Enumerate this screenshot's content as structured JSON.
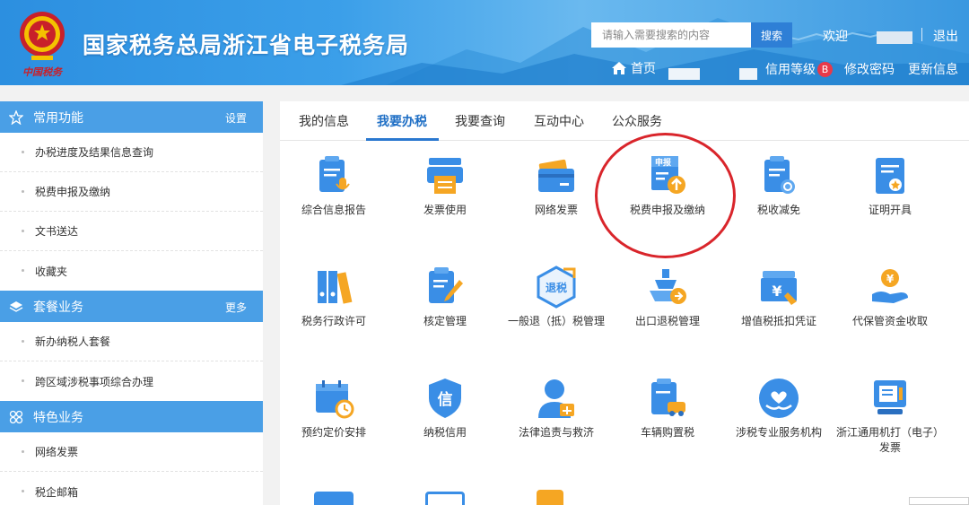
{
  "header": {
    "title": "国家税务总局浙江省电子税务局",
    "search_placeholder": "请输入需要搜索的内容",
    "search_btn": "搜索",
    "welcome": "欢迎",
    "logout": "退出",
    "home": "首页",
    "credit": "信用等级",
    "credit_grade": "B",
    "change_password": "修改密码",
    "update_info": "更新信息"
  },
  "sidebar": {
    "common": {
      "title": "常用功能",
      "action": "设置"
    },
    "common_items": [
      "办税进度及结果信息查询",
      "税费申报及缴纳",
      "文书送达",
      "收藏夹"
    ],
    "package": {
      "title": "套餐业务",
      "action": "更多"
    },
    "package_items": [
      "新办纳税人套餐",
      "跨区域涉税事项综合办理"
    ],
    "special": {
      "title": "特色业务"
    },
    "special_items": [
      "网络发票",
      "税企邮箱"
    ]
  },
  "tabs": [
    "我的信息",
    "我要办税",
    "我要查询",
    "互动中心",
    "公众服务"
  ],
  "active_tab": "我要办税",
  "grid": [
    {
      "label": "综合信息报告",
      "icon": "report-mic-icon"
    },
    {
      "label": "发票使用",
      "icon": "printer-icon"
    },
    {
      "label": "网络发票",
      "icon": "card-icon"
    },
    {
      "label": "税费申报及缴纳",
      "icon": "declare-upload-icon",
      "doc_text": "申报"
    },
    {
      "label": "税收减免",
      "icon": "tax-relief-icon"
    },
    {
      "label": "证明开具",
      "icon": "certificate-icon"
    },
    {
      "label": "税务行政许可",
      "icon": "binders-icon"
    },
    {
      "label": "核定管理",
      "icon": "clipboard-pen-icon"
    },
    {
      "label": "一般退（抵）税管理",
      "icon": "refund-badge-icon",
      "badge_text": "退税"
    },
    {
      "label": "出口退税管理",
      "icon": "ship-icon"
    },
    {
      "label": "增值税抵扣凭证",
      "icon": "yen-voucher-icon",
      "symbol": "¥"
    },
    {
      "label": "代保管资金收取",
      "icon": "hand-coin-icon",
      "symbol": "¥"
    },
    {
      "label": "预约定价安排",
      "icon": "calendar-clock-icon"
    },
    {
      "label": "纳税信用",
      "icon": "credit-shield-icon",
      "badge_text": "信"
    },
    {
      "label": "法律追责与救济",
      "icon": "lawyer-scale-icon"
    },
    {
      "label": "车辆购置税",
      "icon": "car-doc-icon"
    },
    {
      "label": "涉税专业服务机构",
      "icon": "service-heart-icon"
    },
    {
      "label": "浙江通用机打（电子）发票",
      "icon": "machine-invoice-icon"
    }
  ],
  "colors": {
    "header_blue": "#3b9fe9",
    "sidebar_section": "#4a9fe6",
    "active_tab": "#1f6fc5",
    "highlight_circle": "#d9252b",
    "icon_blue": "#3a8ee6",
    "icon_orange": "#f5a623"
  }
}
